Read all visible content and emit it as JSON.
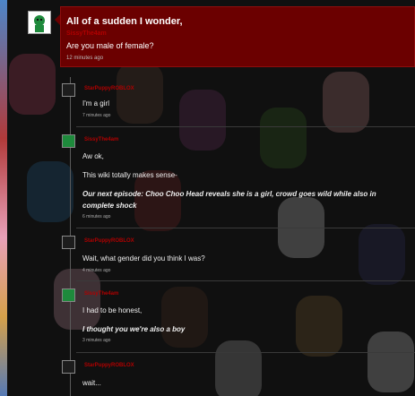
{
  "post": {
    "title": "All of a sudden I wonder,",
    "author": "SissyThe4am",
    "text": "Are you male of female?",
    "time": "12 minutes ago"
  },
  "replies": [
    {
      "author": "StarPuppyROBLOX",
      "lines": [
        "I'm a girl"
      ],
      "time": "7 minutes ago",
      "avatar": "piggy-avatar"
    },
    {
      "author": "SissyThe4am",
      "lines": [
        "Aw ok,",
        "This wiki totally makes sense-",
        "Our next episode: Choo Choo Head reveals she is a girl, crowd goes wild while also in",
        "complete shock"
      ],
      "time": "6 minutes ago",
      "avatar": "sissy-avatar"
    },
    {
      "author": "StarPuppyROBLOX",
      "lines": [
        "Wait, what gender did you think I was?"
      ],
      "time": "4 minutes ago",
      "avatar": "piggy-avatar"
    },
    {
      "author": "SissyThe4am",
      "lines": [
        "I had to be honest,",
        "I thought you we're also a boy"
      ],
      "time": "3 minutes ago",
      "avatar": "sissy-avatar"
    },
    {
      "author": "StarPuppyROBLOX",
      "lines": [
        "wait..."
      ],
      "time": "",
      "avatar": "piggy-avatar"
    }
  ],
  "colors": {
    "post_bg": "#6b0000",
    "author": "#b00000",
    "text": "#ffffff"
  }
}
